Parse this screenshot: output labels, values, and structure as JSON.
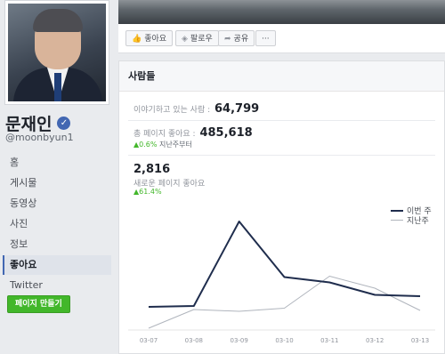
{
  "profile": {
    "name": "문재인",
    "username": "@moonbyun1",
    "verified_icon": "check-circle-icon"
  },
  "nav": {
    "items": [
      {
        "label": "홈",
        "active": false
      },
      {
        "label": "게시물",
        "active": false
      },
      {
        "label": "동영상",
        "active": false
      },
      {
        "label": "사진",
        "active": false
      },
      {
        "label": "정보",
        "active": false
      },
      {
        "label": "좋아요",
        "active": true
      },
      {
        "label": "Twitter",
        "active": false
      }
    ],
    "create_page": "페이지 만들기"
  },
  "actions": {
    "like": "좋아요",
    "follow": "팔로우",
    "share": "공유",
    "more": "···"
  },
  "card": {
    "title": "사람들",
    "talking_label": "이야기하고 있는 사람 :",
    "talking_value": "64,799",
    "total_likes_label": "총 페이지 좋아요 :",
    "total_likes_value": "485,618",
    "total_change": "▲0.6%",
    "total_change_suffix": " 지난주부터",
    "new_likes_value": "2,816",
    "new_likes_label": "새로운 페이지 좋아요",
    "new_likes_change": "▲61.4%"
  },
  "colors": {
    "this_week": "#1f2d4d",
    "last_week": "#b0b5bd",
    "accent": "#4267b2",
    "positive": "#42b72a"
  },
  "chart_data": {
    "type": "line",
    "x": [
      "03-07",
      "03-08",
      "03-09",
      "03-10",
      "03-11",
      "03-12",
      "03-13"
    ],
    "series": [
      {
        "name": "이번 주",
        "values": [
          180,
          200,
          2100,
          850,
          730,
          450,
          420
        ]
      },
      {
        "name": "지난주",
        "values": [
          -300,
          120,
          80,
          150,
          870,
          600,
          100
        ]
      }
    ],
    "ylim": [
      -300,
      2400
    ]
  }
}
